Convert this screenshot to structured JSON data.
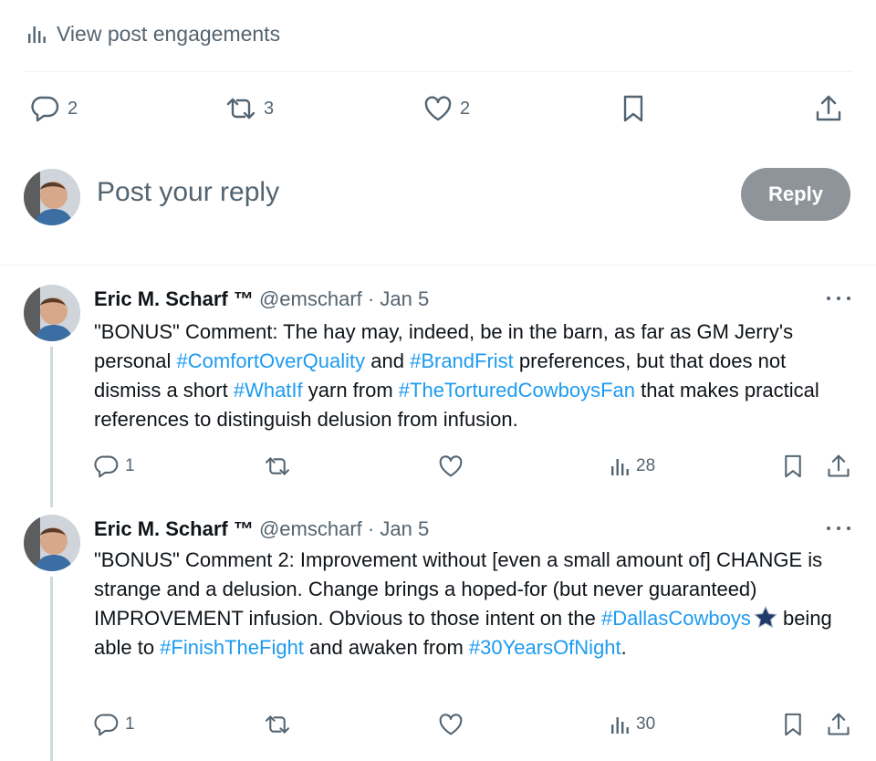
{
  "engagements": {
    "label": "View post engagements",
    "icon": "bar-chart-icon"
  },
  "main_actions": {
    "reply_count": "2",
    "repost_count": "3",
    "like_count": "2"
  },
  "composer": {
    "placeholder": "Post your reply",
    "reply_label": "Reply"
  },
  "tweets": [
    {
      "name": "Eric M. Scharf ™",
      "handle": "@emscharf",
      "sep": "·",
      "date": "Jan 5",
      "body": {
        "p1": "\"BONUS\" Comment: The hay may, indeed, be in the barn, as far as GM Jerry's personal ",
        "tag1": "#ComfortOverQuality",
        "p2": " and ",
        "tag2": "#BrandFrist",
        "p3": " preferences, but that does not dismiss a short ",
        "tag3": "#WhatIf",
        "p4": " yarn from ",
        "tag4": "#TheTorturedCowboysFan",
        "p5": " that makes practical references to distinguish delusion from infusion."
      },
      "replies": "1",
      "views": "28"
    },
    {
      "name": "Eric M. Scharf ™",
      "handle": "@emscharf",
      "sep": "·",
      "date": "Jan 5",
      "body": {
        "p1": "\"BONUS\" Comment 2: Improvement without [even a small amount of] CHANGE is strange and a delusion. Change brings a hoped-for (but never guaranteed) IMPROVEMENT infusion. Obvious to those intent on the ",
        "tag1": "#DallasCowboys",
        "p2": " being able to ",
        "tag2": "#FinishTheFight",
        "p3": " and awaken from ",
        "tag3": "#30YearsOfNight",
        "p4": "."
      },
      "replies": "1",
      "views": "30"
    }
  ],
  "colors": {
    "link": "#1d9bf0",
    "muted": "#536471",
    "reply_button": "#8e9499",
    "star": "#1f3a6b"
  }
}
